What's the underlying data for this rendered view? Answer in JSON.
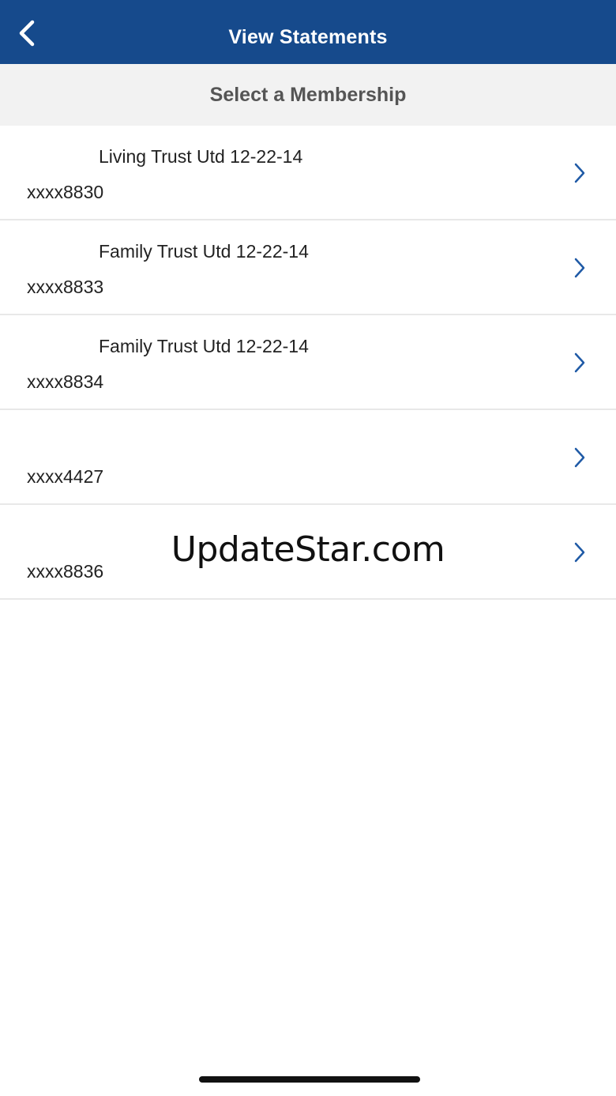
{
  "colors": {
    "nav_background": "#164a8c",
    "chevron": "#1f5aa6",
    "header_background": "#f2f2f2"
  },
  "nav": {
    "title": "View Statements",
    "back_icon": "chevron-left-icon"
  },
  "section_header": "Select a Membership",
  "memberships": [
    {
      "name": "Living Trust Utd 12-22-14",
      "account": "xxxx8830"
    },
    {
      "name": "Family Trust Utd 12-22-14",
      "account": "xxxx8833"
    },
    {
      "name": "Family Trust Utd 12-22-14",
      "account": "xxxx8834"
    },
    {
      "name": "",
      "account": "xxxx4427"
    },
    {
      "name": "",
      "account": "xxxx8836"
    }
  ],
  "row_icon": "chevron-right-icon",
  "watermark": "UpdateStar.com"
}
